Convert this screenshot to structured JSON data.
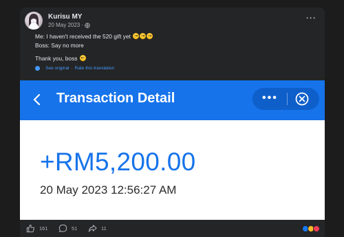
{
  "post": {
    "author": "Kurisu MY",
    "date": "20 May 2023 ·",
    "lines": [
      "Me: I haven't received the 520 gift yet",
      "Boss: Say no more",
      "Thank you, boss"
    ],
    "see_original": "See original",
    "rate_translation": "Rate this translation",
    "separator": "·"
  },
  "screenshot": {
    "title": "Transaction Detail",
    "amount": "+RM5,200.00",
    "datetime": "20 May 2023 12:56:27 AM",
    "dots": "•••",
    "accent": "#1673ea"
  },
  "engagement": {
    "likes": "161",
    "comments": "51",
    "shares": "11"
  },
  "icons": [
    "globe-icon",
    "more-icon",
    "translate-icon",
    "back-icon",
    "close-icon",
    "like-icon",
    "comment-icon",
    "share-icon"
  ]
}
